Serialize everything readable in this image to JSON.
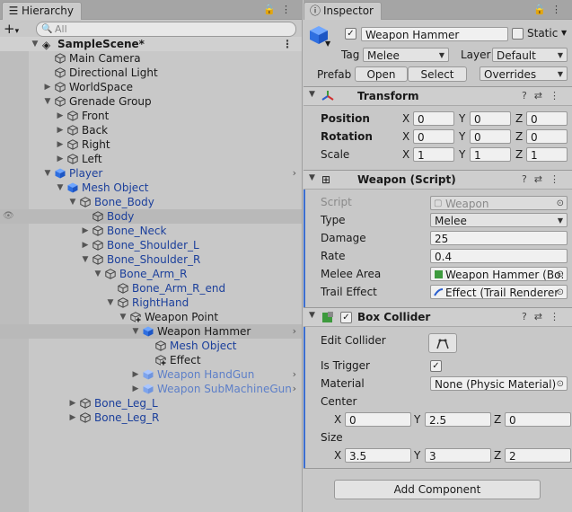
{
  "hierarchy": {
    "tab_label": "Hierarchy",
    "search_placeholder": "All",
    "scene_name": "SampleScene*",
    "rows": [
      {
        "label": "Main Camera",
        "depth": 1
      },
      {
        "label": "Directional Light",
        "depth": 1
      },
      {
        "label": "WorldSpace",
        "depth": 1
      },
      {
        "label": "Grenade Group",
        "depth": 1
      },
      {
        "label": "Front",
        "depth": 2
      },
      {
        "label": "Back",
        "depth": 2
      },
      {
        "label": "Right",
        "depth": 2
      },
      {
        "label": "Left",
        "depth": 2
      },
      {
        "label": "Player",
        "depth": 1
      },
      {
        "label": "Mesh Object",
        "depth": 2
      },
      {
        "label": "Bone_Body",
        "depth": 3
      },
      {
        "label": "Body",
        "depth": 4
      },
      {
        "label": "Bone_Neck",
        "depth": 4
      },
      {
        "label": "Bone_Shoulder_L",
        "depth": 4
      },
      {
        "label": "Bone_Shoulder_R",
        "depth": 4
      },
      {
        "label": "Bone_Arm_R",
        "depth": 5
      },
      {
        "label": "Bone_Arm_R_end",
        "depth": 6
      },
      {
        "label": "RightHand",
        "depth": 6
      },
      {
        "label": "Weapon Point",
        "depth": 7
      },
      {
        "label": "Weapon Hammer",
        "depth": 8
      },
      {
        "label": "Mesh Object",
        "depth": 9
      },
      {
        "label": "Effect",
        "depth": 9
      },
      {
        "label": "Weapon HandGun",
        "depth": 8
      },
      {
        "label": "Weapon SubMachineGun",
        "depth": 8
      },
      {
        "label": "Bone_Leg_L",
        "depth": 3
      },
      {
        "label": "Bone_Leg_R",
        "depth": 3
      }
    ]
  },
  "inspector": {
    "tab_label": "Inspector",
    "object_name": "Weapon Hammer",
    "static_label": "Static",
    "tag_label": "Tag",
    "tag_value": "Melee",
    "layer_label": "Layer",
    "layer_value": "Default",
    "prefab_label": "Prefab",
    "open_label": "Open",
    "select_label": "Select",
    "overrides_label": "Overrides",
    "transform": {
      "title": "Transform",
      "position_label": "Position",
      "rotation_label": "Rotation",
      "scale_label": "Scale",
      "position": {
        "x": "0",
        "y": "0",
        "z": "0"
      },
      "rotation": {
        "x": "0",
        "y": "0",
        "z": "0"
      },
      "scale": {
        "x": "1",
        "y": "1",
        "z": "1"
      }
    },
    "weapon_script": {
      "title": "Weapon (Script)",
      "script_label": "Script",
      "script_value": "Weapon",
      "type_label": "Type",
      "type_value": "Melee",
      "damage_label": "Damage",
      "damage_value": "25",
      "rate_label": "Rate",
      "rate_value": "0.4",
      "melee_area_label": "Melee Area",
      "melee_area_value": "Weapon Hammer (Bo:",
      "trail_effect_label": "Trail Effect",
      "trail_effect_value": "Effect (Trail Renderer"
    },
    "box_collider": {
      "title": "Box Collider",
      "edit_collider_label": "Edit Collider",
      "is_trigger_label": "Is Trigger",
      "material_label": "Material",
      "material_value": "None (Physic Material)",
      "center_label": "Center",
      "size_label": "Size",
      "center": {
        "x": "0",
        "y": "2.5",
        "z": "0"
      },
      "size": {
        "x": "3.5",
        "y": "3",
        "z": "2"
      }
    },
    "add_component_label": "Add Component"
  },
  "axis_letters": {
    "x": "X",
    "y": "Y",
    "z": "Z"
  },
  "colors": {
    "prefab_text": "#1b3f9b",
    "selection": "#b9b9b9",
    "accent": "#3c6fd1"
  }
}
